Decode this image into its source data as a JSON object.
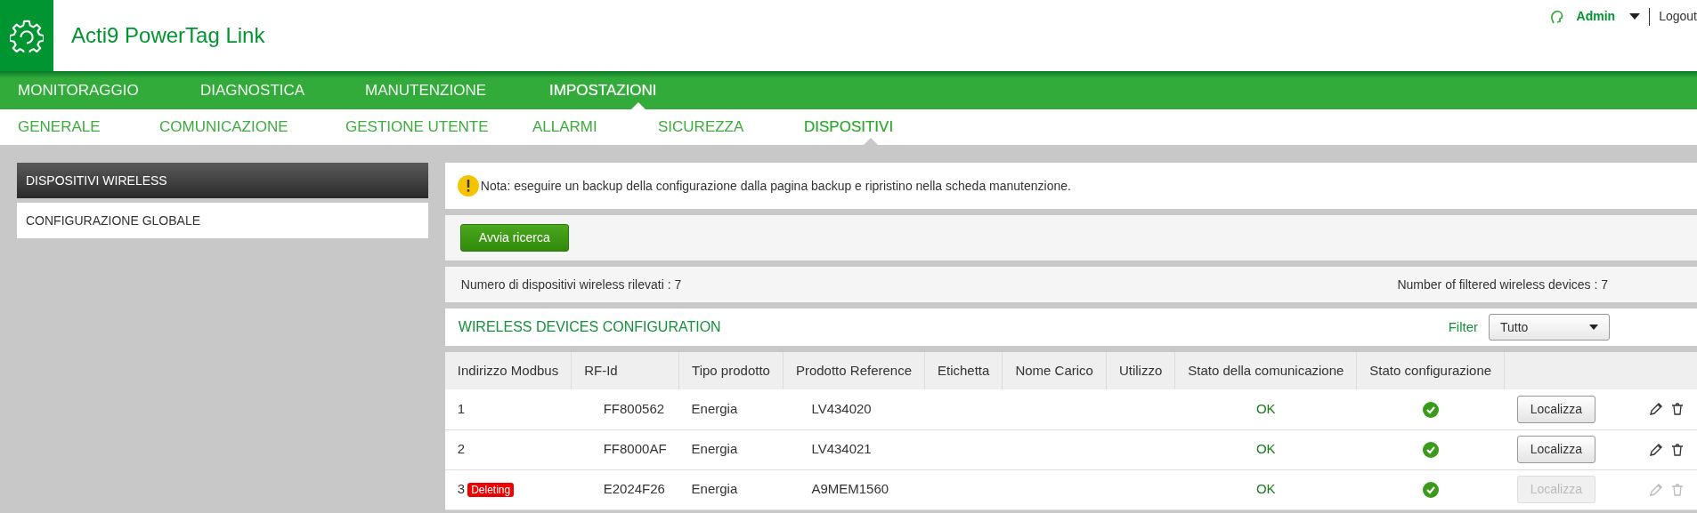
{
  "app": {
    "title": "Acti9 PowerTag Link"
  },
  "user": {
    "name": "Admin",
    "logout": "Logout"
  },
  "main_nav": [
    {
      "label": "MONITORAGGIO",
      "selected": false
    },
    {
      "label": "DIAGNOSTICA",
      "selected": false
    },
    {
      "label": "MANUTENZIONE",
      "selected": false
    },
    {
      "label": "IMPOSTAZIONI",
      "selected": true
    }
  ],
  "sub_nav": [
    {
      "label": "GENERALE",
      "selected": false
    },
    {
      "label": "COMUNICAZIONE",
      "selected": false
    },
    {
      "label": "GESTIONE UTENTE",
      "selected": false
    },
    {
      "label": "ALLARMI",
      "selected": false
    },
    {
      "label": "SICUREZZA",
      "selected": false
    },
    {
      "label": "DISPOSITIVI",
      "selected": true
    }
  ],
  "sidebar": {
    "items": [
      {
        "label": "DISPOSITIVI WIRELESS",
        "selected": true
      },
      {
        "label": "CONFIGURAZIONE GLOBALE",
        "selected": false
      }
    ]
  },
  "note": "Nota: eseguire un backup della configurazione dalla pagina backup e ripristino nella scheda manutenzione.",
  "search_button": "Avvia ricerca",
  "counts": {
    "detected": "Numero di dispositivi wireless rilevati : 7",
    "filtered": "Number of filtered wireless devices : 7"
  },
  "config": {
    "title": "WIRELESS DEVICES CONFIGURATION",
    "filter_label": "Filter",
    "filter_value": "Tutto"
  },
  "table": {
    "columns": [
      "Indirizzo Modbus",
      "RF-Id",
      "Tipo prodotto",
      "Prodotto Reference",
      "Etichetta",
      "Nome Carico",
      "Utilizzo",
      "Stato della comunicazione",
      "Stato configurazione"
    ],
    "rows": [
      {
        "modbus": "1",
        "rf_id": "FF800562",
        "type": "Energia",
        "reference": "LV434020",
        "communication": "OK",
        "configured": true,
        "locate": "Localizza",
        "disabled": false
      },
      {
        "modbus": "2",
        "rf_id": "FF8000AF",
        "type": "Energia",
        "reference": "LV434021",
        "communication": "OK",
        "configured": true,
        "locate": "Localizza",
        "disabled": false
      },
      {
        "modbus": "3",
        "badge": "Deleting",
        "rf_id": "E2024F26",
        "type": "Energia",
        "reference": "A9MEM1560",
        "communication": "OK",
        "configured": true,
        "locate": "Localizza",
        "disabled": true
      }
    ]
  }
}
